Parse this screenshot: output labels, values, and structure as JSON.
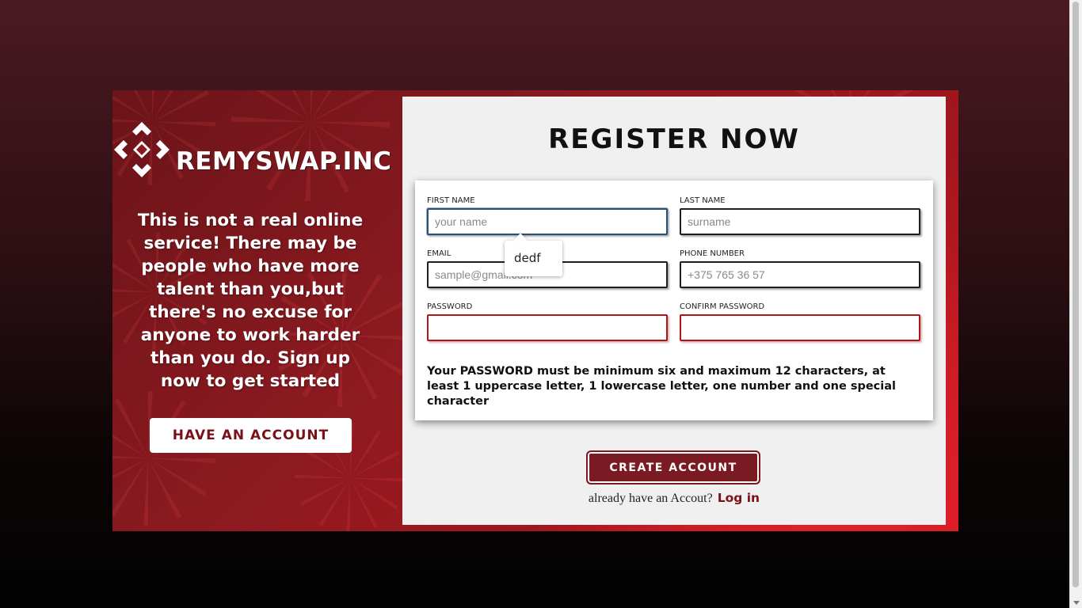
{
  "brand": {
    "name": "REMYSWAP.INC",
    "logo_icon": "binance-diamond-logo"
  },
  "left_panel": {
    "tagline": "This is not a real online service! There may be people who have more talent than you,but there's no excuse for anyone to work harder than you do. Sign up now to get started",
    "have_account_button": "HAVE AN ACCOUNT"
  },
  "register": {
    "title": "REGISTER NOW",
    "fields": {
      "first_name": {
        "label": "FIRST NAME",
        "placeholder": "your name",
        "value": ""
      },
      "last_name": {
        "label": "LAST NAME",
        "placeholder": "surname",
        "value": ""
      },
      "email": {
        "label": "EMAIL",
        "placeholder": "sample@gmail.com",
        "value": ""
      },
      "phone": {
        "label": "PHONE NUMBER",
        "placeholder": "+375 765 36 57",
        "value": ""
      },
      "password": {
        "label": "PASSWORD",
        "placeholder": "",
        "value": ""
      },
      "confirm_password": {
        "label": "CONFIRM PASSWORD",
        "placeholder": "",
        "value": ""
      }
    },
    "autocomplete_suggestion": "dedf",
    "password_hint": "Your PASSWORD must be minimum six and maximum 12 characters, at least 1 uppercase letter, 1 lowercase letter, one number and one special character",
    "create_account_button": "CREATE ACCOUNT",
    "login_prompt": "already have an Accout?",
    "login_link": "Log in"
  },
  "colors": {
    "accent": "#7a1a22",
    "panel_bg": "#f0f0f0",
    "invalid_border": "#b3141c"
  }
}
